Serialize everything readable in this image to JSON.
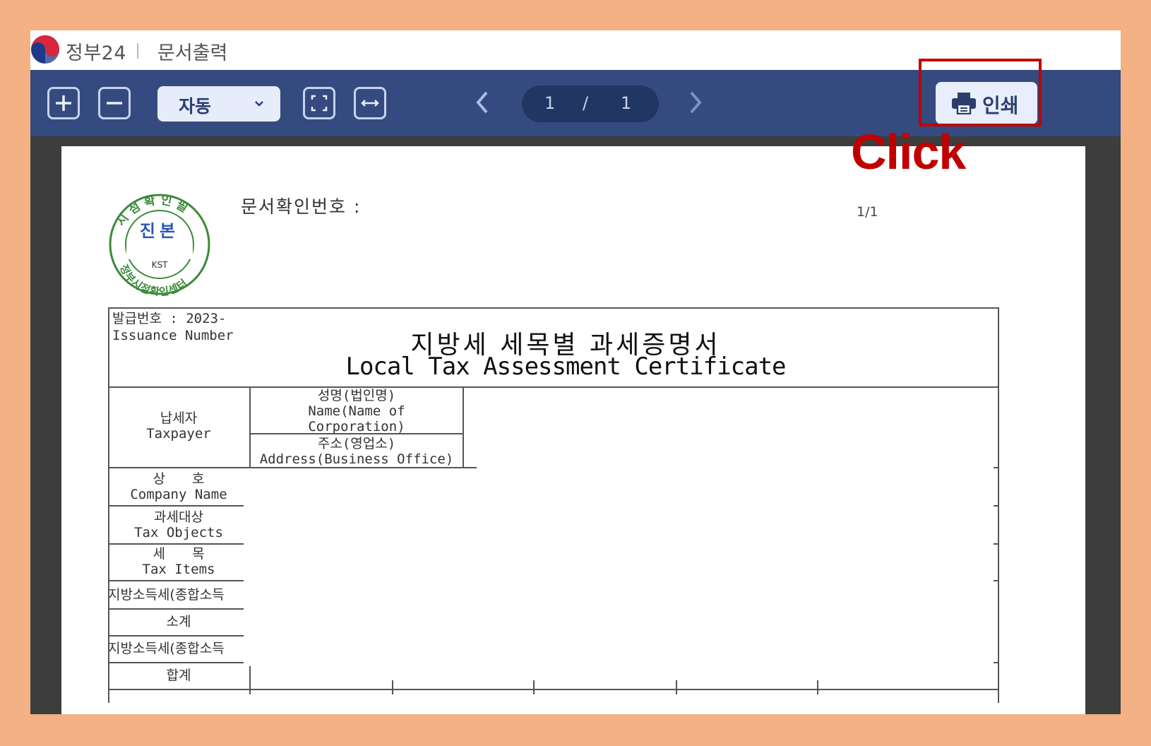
{
  "app": {
    "brand": "정부24",
    "doc_title": "문서출력"
  },
  "toolbar": {
    "zoom_in_icon": "plus-square-icon",
    "zoom_out_icon": "minus-square-icon",
    "zoom_mode": "자동",
    "fit_page_icon": "fit-page-icon",
    "fit_width_icon": "fit-width-icon",
    "current_page": "1",
    "page_separator": "/",
    "total_pages": "1",
    "print_label": "인쇄"
  },
  "annotation": {
    "click_label": "Click",
    "highlight_color": "#c00000"
  },
  "document": {
    "confirm_number_label": "문서확인번호 :",
    "page_indicator": "1/1",
    "stamp": {
      "top_arc": "시점확인필",
      "center": "진본",
      "code": "KST",
      "bottom_arc": "정부시점확인센터"
    },
    "issuance_line1": "발급번호 : 2023-",
    "issuance_line2": "Issuance Number",
    "title_ko": "지방세 세목별 과세증명서",
    "title_en": "Local Tax Assessment Certificate",
    "taxpayer_ko": "납세자",
    "taxpayer_en": "Taxpayer",
    "name_ko": "성명(법인명)",
    "name_en1": "Name(Name of",
    "name_en2": "Corporation)",
    "address_ko": "주소(영업소)",
    "address_en": "Address(Business Office)",
    "company_ko": "상　　호",
    "company_en": "Company Name",
    "taxobj_ko": "과세대상",
    "taxobj_en": "Tax Objects",
    "taxitem_ko": "세　　목",
    "taxitem_en": "Tax Items",
    "row_income1": "지방소득세(종합소득",
    "row_subtotal": "소계",
    "row_income2": "지방소득세(종합소득",
    "row_total": "합계"
  },
  "colors": {
    "outer_border": "#f3b184",
    "toolbar": "#354a7f",
    "viewer_bg": "#3d3d3d",
    "stamp_green": "#3b8a3a",
    "stamp_blue": "#2a57b5"
  }
}
